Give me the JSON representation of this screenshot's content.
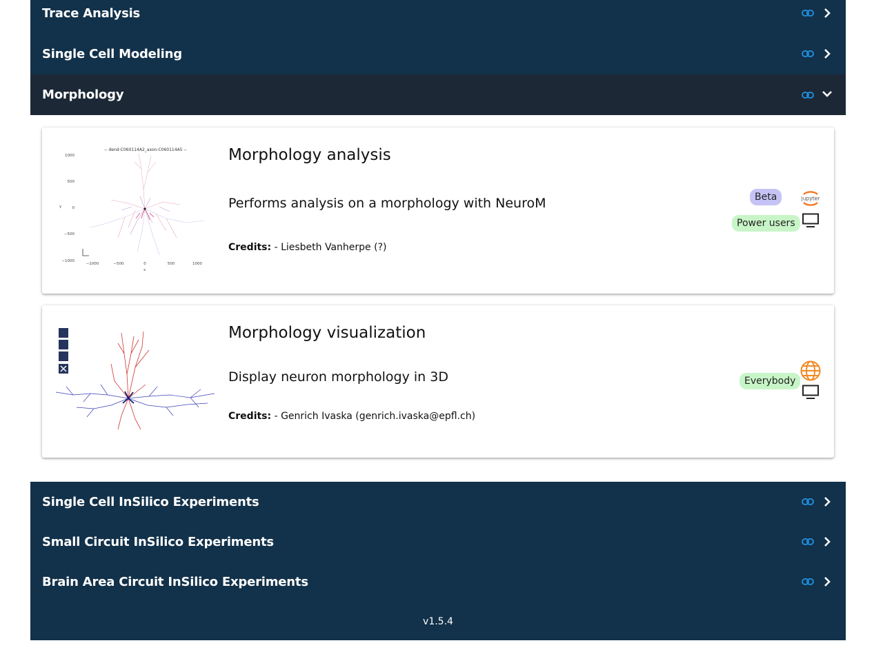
{
  "categories_top": [
    {
      "label": "Trace Analysis",
      "expanded": false
    },
    {
      "label": "Single Cell Modeling",
      "expanded": false
    },
    {
      "label": "Morphology",
      "expanded": true
    }
  ],
  "cards": [
    {
      "title": "Morphology analysis",
      "description": "Performs analysis on a morphology with NeuroM",
      "credits_label": "Credits:",
      "credits_value": " - Liesbeth Vanherpe (?)",
      "badges": [
        "Beta",
        "Power users"
      ],
      "icons": [
        "jupyter-icon",
        "monitor-icon"
      ],
      "plot": {
        "title": "-- dend-C060114A2_axon-C060114A5 --",
        "y_ticks": [
          "1000",
          "500",
          "0",
          "−500",
          "−1000"
        ],
        "x_ticks": [
          "−1000",
          "−500",
          "0",
          "500",
          "1000"
        ],
        "xlabel": "x",
        "ylabel": "y"
      },
      "jupyter_text": "jupyter"
    },
    {
      "title": "Morphology visualization",
      "description": "Display neuron morphology in 3D",
      "credits_label": "Credits:",
      "credits_value": " - Genrich Ivaska (genrich.ivaska@epfl.ch)",
      "badges": [
        "Everybody"
      ],
      "icons": [
        "globe-icon",
        "monitor-icon"
      ]
    }
  ],
  "categories_bottom": [
    {
      "label": "Single Cell InSilico Experiments",
      "expanded": false
    },
    {
      "label": "Small Circuit InSilico Experiments",
      "expanded": false
    },
    {
      "label": "Brain Area Circuit InSilico Experiments",
      "expanded": false
    }
  ],
  "footer": {
    "version": "v1.5.4"
  },
  "colors": {
    "panel": "#12314a",
    "active_row": "#1c2836",
    "link_icon": "#1f8bd6",
    "beta_badge": "#c5c3f5",
    "audience_badge": "#c8f5c8",
    "jupyter_orange": "#f37726"
  }
}
